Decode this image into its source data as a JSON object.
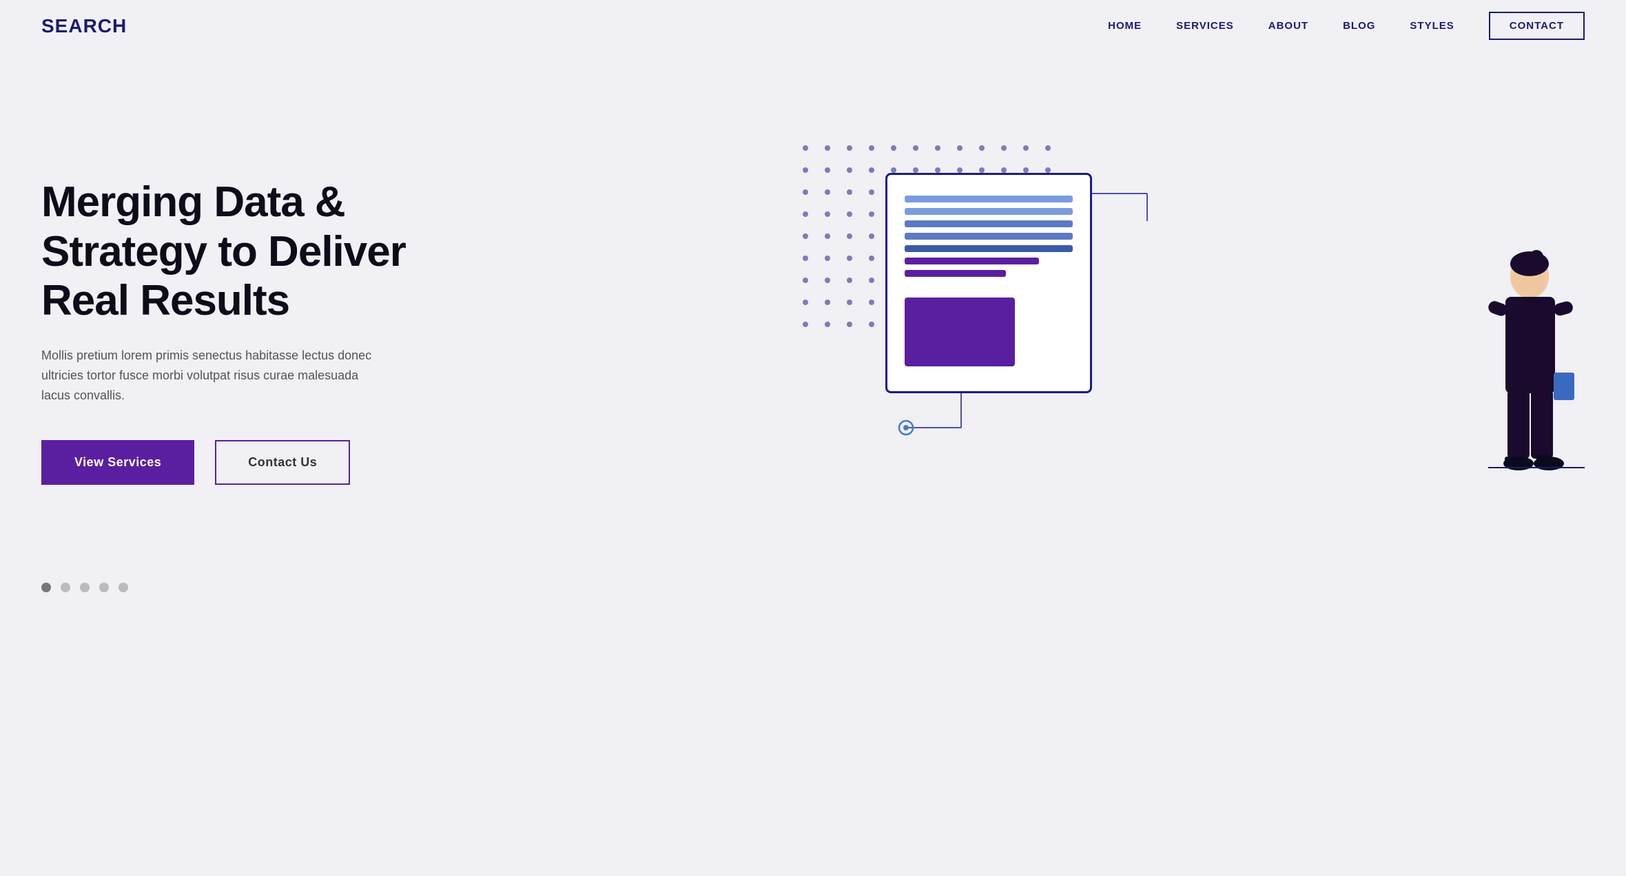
{
  "brand": {
    "logo": "SEARCH"
  },
  "navbar": {
    "links": [
      {
        "label": "HOME",
        "id": "home"
      },
      {
        "label": "SERVICES",
        "id": "services"
      },
      {
        "label": "ABOUT",
        "id": "about"
      },
      {
        "label": "BLOG",
        "id": "blog"
      },
      {
        "label": "STYLES",
        "id": "styles"
      },
      {
        "label": "CONTACT",
        "id": "contact",
        "isButton": true
      }
    ]
  },
  "hero": {
    "title": "Merging Data & Strategy to Deliver Real Results",
    "subtitle": "Mollis pretium lorem primis senectus habitasse lectus donec ultricies tortor fusce morbi volutpat risus curae malesuada lacus convallis.",
    "btn_primary": "View Services",
    "btn_secondary": "Contact Us"
  },
  "colors": {
    "accent_purple": "#5a1fa0",
    "navy": "#1a1a6e",
    "background": "#f0f0f5"
  }
}
